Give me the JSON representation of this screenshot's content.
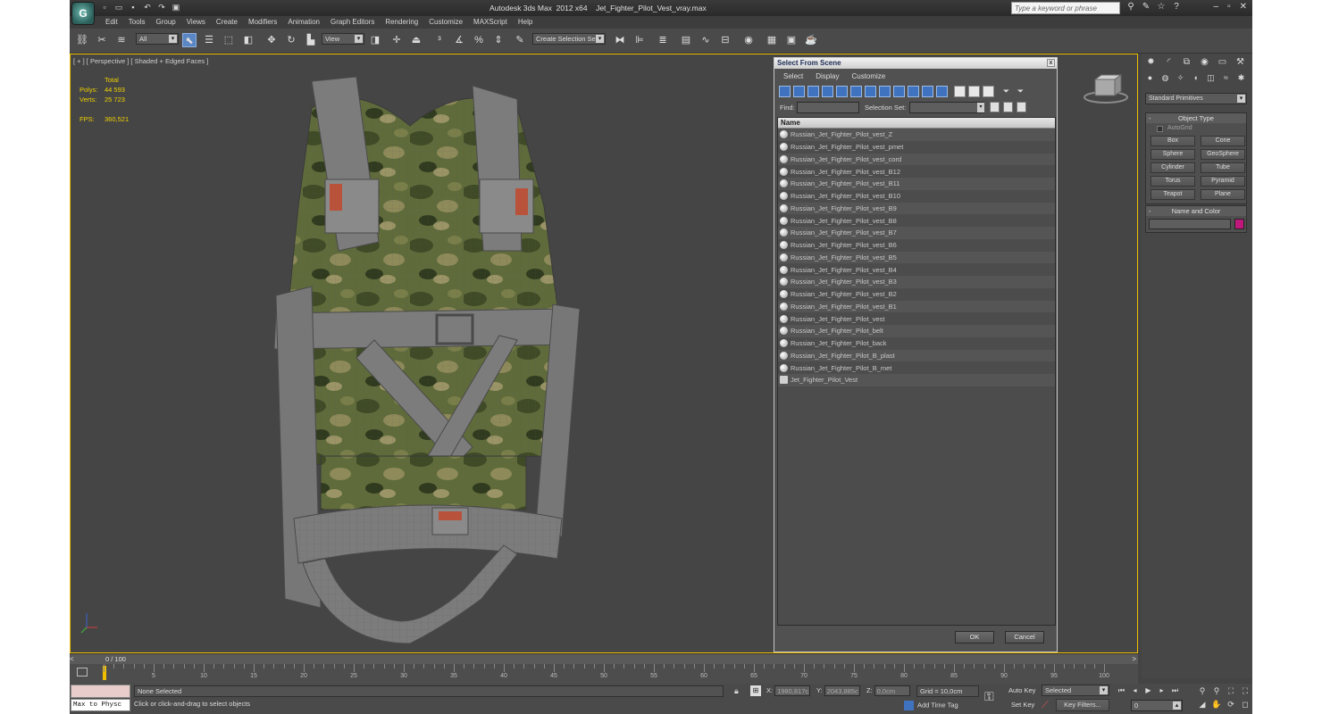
{
  "app": {
    "title": "Autodesk 3ds Max  2012 x64    Jet_Fighter_Pilot_Vest_vray.max",
    "search_placeholder": "Type a keyword or phrase",
    "logo": "3ds-max-logo"
  },
  "menu": [
    "Edit",
    "Tools",
    "Group",
    "Views",
    "Create",
    "Modifiers",
    "Animation",
    "Graph Editors",
    "Rendering",
    "Customize",
    "MAXScript",
    "Help"
  ],
  "toolbar": {
    "filter_value": "All",
    "coord_value": "View",
    "selection_set_value": "Create Selection Se"
  },
  "viewport": {
    "label": "[ + ] [ Perspective ] [ Shaded + Edged Faces ]",
    "stats": {
      "total_label": "Total",
      "polys_label": "Polys:",
      "polys_value": "44 593",
      "verts_label": "Verts:",
      "verts_value": "25 723",
      "fps_label": "FPS:",
      "fps_value": "360,521"
    },
    "vest_colors": {
      "camo_base": "#5f6b3a",
      "strap": "#7c7c7c",
      "accent": "#b8523a"
    }
  },
  "dialog": {
    "title": "Select From Scene",
    "menu": [
      "Select",
      "Display",
      "Customize"
    ],
    "find_label": "Find:",
    "selection_set_label": "Selection Set:",
    "column_name": "Name",
    "items": [
      "Russian_Jet_Fighter_Pilot_vest_Z",
      "Russian_Jet_Fighter_Pilot_vest_pmet",
      "Russian_Jet_Fighter_Pilot_vest_cord",
      "Russian_Jet_Fighter_Pilot_vest_B12",
      "Russian_Jet_Fighter_Pilot_vest_B11",
      "Russian_Jet_Fighter_Pilot_vest_B10",
      "Russian_Jet_Fighter_Pilot_vest_B9",
      "Russian_Jet_Fighter_Pilot_vest_B8",
      "Russian_Jet_Fighter_Pilot_vest_B7",
      "Russian_Jet_Fighter_Pilot_vest_B6",
      "Russian_Jet_Fighter_Pilot_vest_B5",
      "Russian_Jet_Fighter_Pilot_vest_B4",
      "Russian_Jet_Fighter_Pilot_vest_B3",
      "Russian_Jet_Fighter_Pilot_vest_B2",
      "Russian_Jet_Fighter_Pilot_vest_B1",
      "Russian_Jet_Fighter_Pilot_vest",
      "Russian_Jet_Fighter_Pilot_belt",
      "Russian_Jet_Fighter_Pilot_back",
      "Russian_Jet_Fighter_Pilot_B_plast",
      "Russian_Jet_Fighter_Pilot_B_met"
    ],
    "group_item": "Jet_Fighter_Pilot_Vest",
    "ok_label": "OK",
    "cancel_label": "Cancel"
  },
  "command_panel": {
    "category": "Standard Primitives",
    "object_type_title": "Object Type",
    "autogrid_label": "AutoGrid",
    "objects": [
      "Box",
      "Cone",
      "Sphere",
      "GeoSphere",
      "Cylinder",
      "Tube",
      "Torus",
      "Pyramid",
      "Teapot",
      "Plane"
    ],
    "name_color_title": "Name and Color",
    "object_color": "#c0187a"
  },
  "timeline": {
    "frame_label": "0 / 100",
    "ticks": [
      "5",
      "10",
      "15",
      "20",
      "25",
      "30",
      "35",
      "40",
      "45",
      "50",
      "55",
      "60",
      "65",
      "70",
      "75",
      "80",
      "85",
      "90",
      "95",
      "100"
    ]
  },
  "status": {
    "maxscript_label": "Max to Physc",
    "selection_text": "None Selected",
    "prompt_text": "Click or click-and-drag to select objects",
    "x_label": "X:",
    "x_value": "1980,817c",
    "y_label": "Y:",
    "y_value": "2043,885c",
    "z_label": "Z:",
    "z_value": "0,0cm",
    "grid_text": "Grid = 10,0cm",
    "add_time_tag": "Add Time Tag",
    "auto_key_label": "Auto Key",
    "set_key_label": "Set Key",
    "selected_value": "Selected",
    "key_filters_label": "Key Filters...",
    "frame_value": "0"
  }
}
